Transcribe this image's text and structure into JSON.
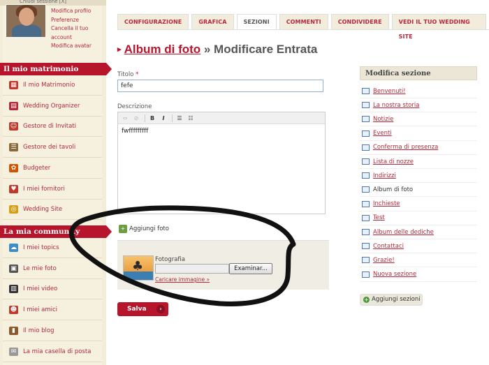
{
  "topbar": {
    "text": "Chiudi sessione [X]"
  },
  "account": {
    "links": [
      "Modifica profilo",
      "Preferenze",
      "Cancella il tuo",
      "account",
      "Modifica avatar"
    ]
  },
  "sidebar": {
    "section1_title": "Il mio matrimonio",
    "section1_items": [
      {
        "label": "Il mio Matrimonio",
        "icon": "calendar-icon"
      },
      {
        "label": "Wedding Organizer",
        "icon": "planner-icon"
      },
      {
        "label": "Gestore di Invitati",
        "icon": "guests-icon"
      },
      {
        "label": "Gestore dei tavoli",
        "icon": "tables-icon"
      },
      {
        "label": "Budgeter",
        "icon": "budget-icon"
      },
      {
        "label": "I miei fornitori",
        "icon": "heart-icon"
      },
      {
        "label": "Wedding Site",
        "icon": "rings-icon"
      }
    ],
    "section2_title": "La mia community",
    "section2_items": [
      {
        "label": "I miei topics",
        "icon": "chat-icon"
      },
      {
        "label": "Le mie foto",
        "icon": "camera-icon"
      },
      {
        "label": "I miei video",
        "icon": "film-icon"
      },
      {
        "label": "I miei amici",
        "icon": "friends-icon"
      },
      {
        "label": "Il mio blog",
        "icon": "blog-icon"
      },
      {
        "label": "La mia casella di posta",
        "icon": "mail-icon"
      }
    ]
  },
  "tabs": [
    "CONFIGURAZIONE",
    "GRAFICA",
    "SEZIONI",
    "COMMENTI",
    "CONDIVIDERE",
    "VEDI IL TUO WEDDING SITE"
  ],
  "active_tab": "SEZIONI",
  "page": {
    "title_link": "Album di foto",
    "title_rest": " » Modificare Entrata"
  },
  "form": {
    "title_label": "Titolo",
    "required_mark": "*",
    "title_value": "fefe",
    "desc_label": "Descrizione",
    "desc_value": "fwfffffffff",
    "toolbar": [
      "⇔",
      "⊘",
      "B",
      "I",
      "☰",
      "☷"
    ],
    "add_photo": "Aggiungi foto",
    "photo_label": "Fotografia",
    "browse_label": "Examinar...",
    "upload_link": "Caricare immagine »",
    "save_label": "Salva",
    "save_arrow": "›"
  },
  "right": {
    "title": "Modifica sezione",
    "items": [
      "Benvenuti!",
      "La nostra storia",
      "Notizie",
      "Eventi",
      "Conferma di presenza",
      "Lista di nozze",
      "Indirizzi",
      "Album di foto",
      "Inchieste",
      "Test",
      "Album delle dediche",
      "Contattaci",
      "Grazie!",
      "Nuova sezione"
    ],
    "current": "Album di foto",
    "add_label": "Aggiungi sezioni"
  },
  "colors": {
    "brand_red": "#b6152c",
    "sidebar_bg": "#f6f0df",
    "scribble": "#111111"
  }
}
